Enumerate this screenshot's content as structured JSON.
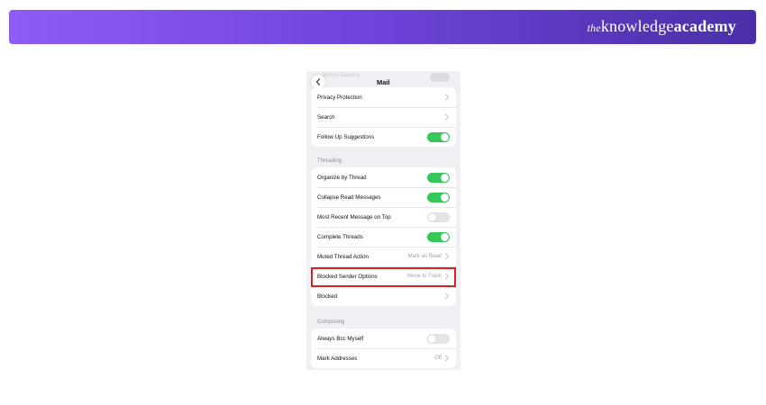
{
  "brand": {
    "prefix": "the",
    "knowledge": "knowledge",
    "academy": "academy"
  },
  "screen": {
    "title": "Mail",
    "ghost_row_label": "Before Deleting",
    "group_top": [
      {
        "label": "Privacy Protection",
        "control": "chevron"
      },
      {
        "label": "Search",
        "control": "chevron"
      },
      {
        "label": "Follow Up Suggestions",
        "control": "toggle",
        "on": true
      }
    ],
    "threading_header": "Threading",
    "threading": [
      {
        "label": "Organize by Thread",
        "control": "toggle",
        "on": true
      },
      {
        "label": "Collapse Read Messages",
        "control": "toggle",
        "on": true
      },
      {
        "label": "Most Recent Message on Top",
        "control": "toggle",
        "on": false
      },
      {
        "label": "Complete Threads",
        "control": "toggle",
        "on": true
      },
      {
        "label": "Muted Thread Action",
        "value": "Mark as Read",
        "control": "chevron"
      },
      {
        "label": "Blocked Sender Options",
        "value": "Move to Trash",
        "control": "chevron",
        "highlighted": true
      },
      {
        "label": "Blocked",
        "control": "chevron"
      }
    ],
    "composing_header": "Composing",
    "composing": [
      {
        "label": "Always Bcc Myself",
        "control": "toggle",
        "on": false
      },
      {
        "label": "Mark Addresses",
        "value": "Off",
        "control": "chevron"
      }
    ]
  },
  "colors": {
    "toggle_on": "#34c759",
    "toggle_off": "#e3e3e8",
    "highlight": "#e02020",
    "banner_start": "#8e5cf2",
    "banner_end": "#4a2fa8"
  }
}
